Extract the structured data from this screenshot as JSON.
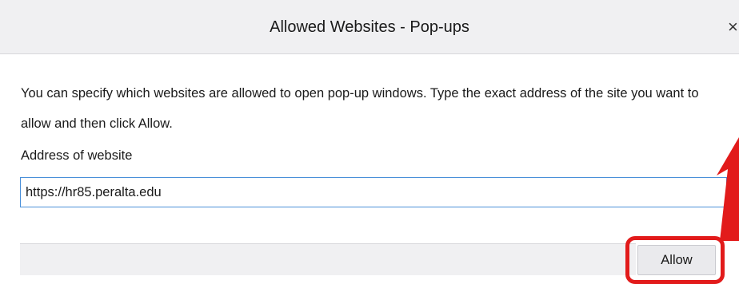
{
  "dialog": {
    "title": "Allowed Websites - Pop-ups",
    "close_glyph": "×",
    "description": "You can specify which websites are allowed to open pop-up windows. Type the exact address of the site you want to allow and then click Allow.",
    "address_label": "Address of website",
    "address_value": "https://hr85.peralta.edu",
    "allow_label": "Allow"
  },
  "annotation": {
    "highlight_color": "#e21b1b",
    "arrow_color": "#e21b1b"
  },
  "colors": {
    "titlebar_bg": "#f0f0f2",
    "input_border": "#4a90d9"
  }
}
